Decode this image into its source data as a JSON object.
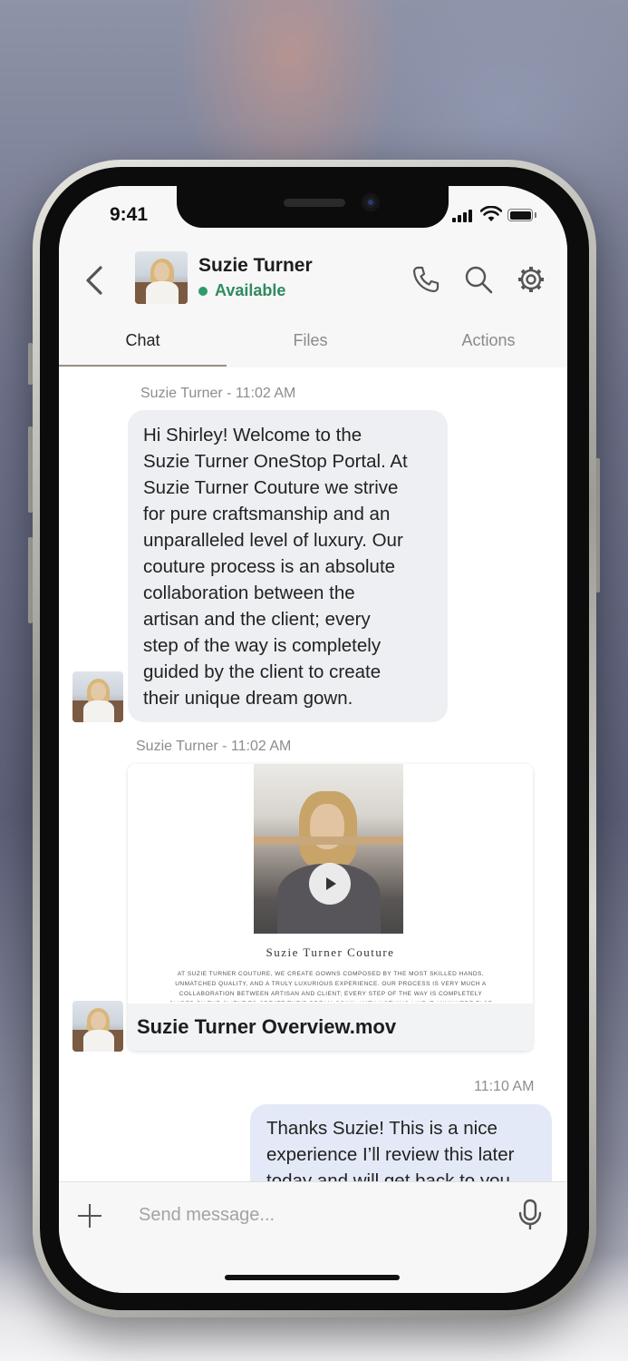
{
  "status_bar": {
    "time": "9:41"
  },
  "header": {
    "contact_name": "Suzie Turner",
    "presence": "Available",
    "presence_color": "#2f9b68"
  },
  "icons": [
    "back-chevron-icon",
    "phone-icon",
    "search-icon",
    "gear-icon",
    "play-icon",
    "plus-icon",
    "microphone-icon"
  ],
  "tabs": [
    {
      "label": "Chat",
      "active": true
    },
    {
      "label": "Files",
      "active": false
    },
    {
      "label": "Actions",
      "active": false
    }
  ],
  "messages": [
    {
      "meta": "Suzie Turner - 11:02 AM",
      "text": "Hi Shirley! Welcome to the\nSuzie Turner OneStop Portal. At\nSuzie Turner Couture we strive\nfor pure craftsmanship and an\nunparalleled level of luxury. Our\ncouture process is an absolute\ncollaboration between the\nartisan and the client; every\nstep of the way is completely\nguided by the client to create\ntheir unique dream gown."
    },
    {
      "meta": "Suzie Turner - 11:02 AM",
      "attachment": {
        "title": "Suzie Turner Couture",
        "description": "AT SUZIE TURNER COUTURE, WE CREATE GOWNS COMPOSED BY THE MOST SKILLED HANDS, UNMATCHED QUALITY, AND A TRULY LUXURIOUS EXPERIENCE. OUR PROCESS IS VERY MUCH A COLLABORATION BETWEEN ARTISAN AND CLIENT; EVERY STEP OF THE WAY IS COMPLETELY GUIDED BY THE CLIENT TO CREATE THEIR DREAM GOWN, WITH NOTHING LIKE IT ANYWHERE ELSE IN THE WORLD.",
        "filename": "Suzie Turner Overview.mov"
      }
    },
    {
      "meta": "11:10 AM",
      "text": "Thanks Suzie! This is a nice\nexperience I’ll review this later\ntoday and will get back to you"
    }
  ],
  "composer": {
    "placeholder": "Send message..."
  },
  "colors": {
    "outgoing_bubble": "#e4e9f7",
    "incoming_bubble": "#eeeff2",
    "tab_underline": "#9a8f84"
  }
}
